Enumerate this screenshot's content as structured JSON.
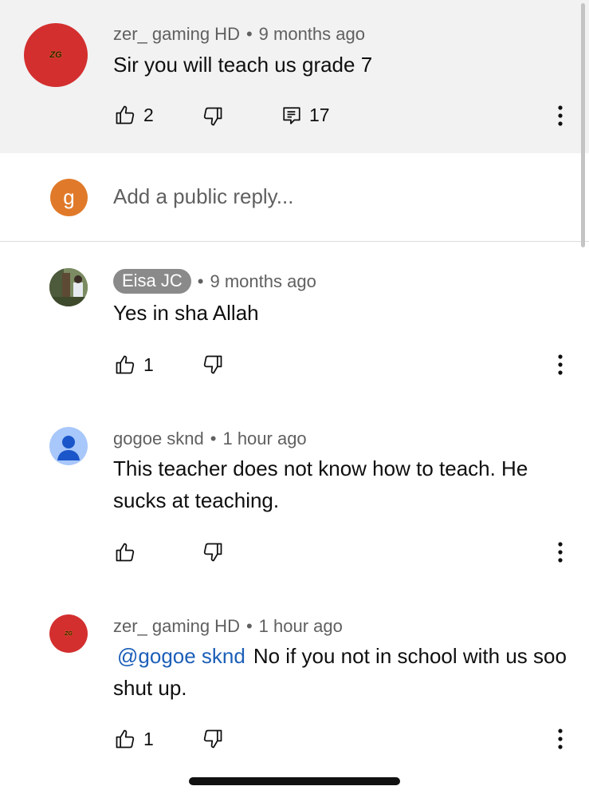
{
  "comments": [
    {
      "author": "zer_ gaming HD",
      "time": "9 months ago",
      "text": "Sir you will teach us grade 7",
      "likes": "2",
      "replies": "17",
      "avatar_text": "ZG"
    },
    {
      "author": "Eisa JC",
      "time": "9 months ago",
      "text": "Yes in sha Allah",
      "likes": "1"
    },
    {
      "author": "gogoe sknd",
      "time": "1 hour ago",
      "text": "This teacher does not know how to teach. He sucks at teaching."
    },
    {
      "author": "zer_ gaming HD",
      "time": "1 hour ago",
      "mention": "@gogoe sknd",
      "text": "No if you not in school with us soo shut up.",
      "likes": "1",
      "avatar_text": "ZG"
    }
  ],
  "reply_box": {
    "avatar_letter": "g",
    "placeholder": "Add a public reply..."
  },
  "separator": "•",
  "colors": {
    "top_bg": "#f2f2f2",
    "mention": "#1c5fb8",
    "meta": "#606060",
    "avatar_red": "#d32f2f",
    "avatar_orange": "#e07a2a",
    "avatar_blue": "#a8c7fa"
  },
  "icons": [
    "thumbs-up-icon",
    "thumbs-down-icon",
    "reply-icon",
    "more-vert-icon",
    "person-icon"
  ]
}
